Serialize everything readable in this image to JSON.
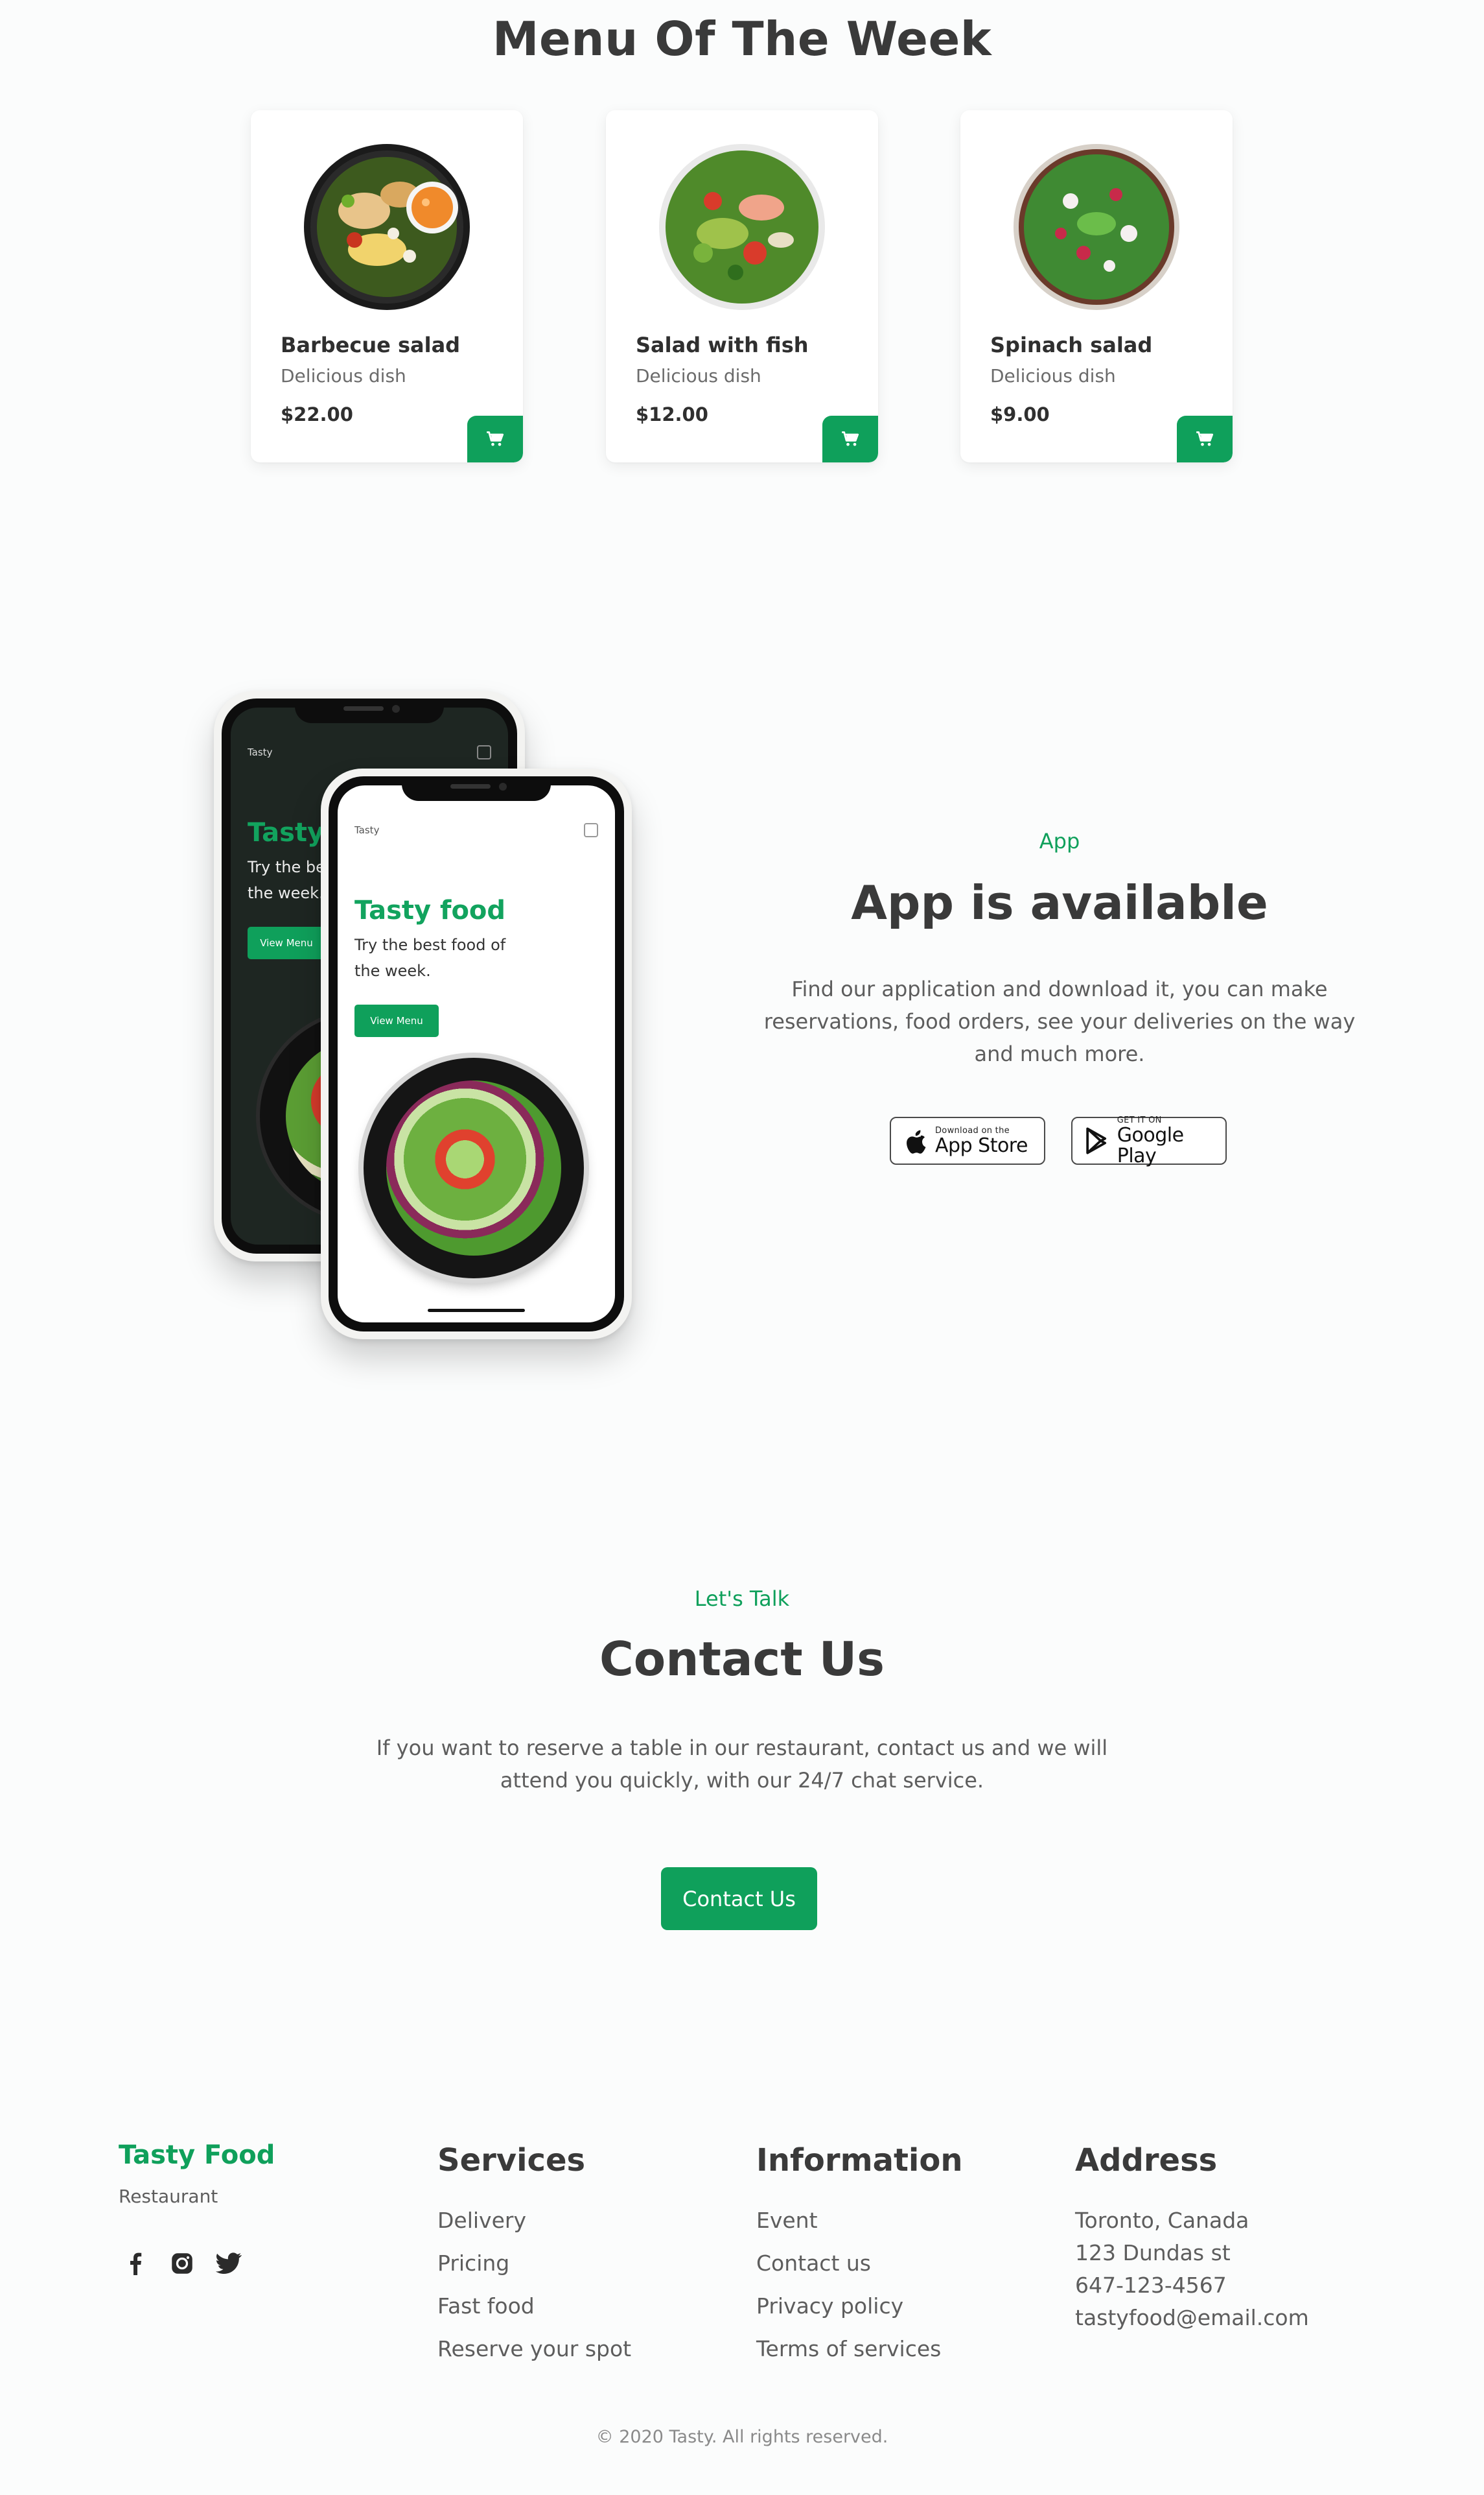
{
  "menu": {
    "title": "Menu Of The Week",
    "items": [
      {
        "name": "Barbecue salad",
        "desc": "Delicious dish",
        "price": "$22.00"
      },
      {
        "name": "Salad with fish",
        "desc": "Delicious dish",
        "price": "$12.00"
      },
      {
        "name": "Spinach salad",
        "desc": "Delicious dish",
        "price": "$9.00"
      }
    ],
    "cart_icon": "cart-icon"
  },
  "app": {
    "eyebrow": "App",
    "title": "App is available",
    "description_lines": [
      "Find our application and download it, you can make",
      "reservations, food orders, see your deliveries on the way",
      "and much more."
    ],
    "app_store": {
      "small": "Download on the",
      "big": "App Store"
    },
    "google_play": {
      "small": "GET IT ON",
      "big": "Google Play"
    },
    "phone_back": {
      "brand": "Tasty",
      "headline": "Tasty food",
      "line1": "Try the best food of",
      "line2": "the week.",
      "button": "View Menu"
    },
    "phone_front": {
      "brand": "Tasty",
      "headline": "Tasty food",
      "line1": "Try the best food of",
      "line2": "the week.",
      "button": "View Menu"
    }
  },
  "contact": {
    "eyebrow": "Let's Talk",
    "title": "Contact Us",
    "description_lines": [
      "If you want to reserve a table in our restaurant, contact us and we will",
      "attend you quickly, with our 24/7 chat service."
    ],
    "button": "Contact Us"
  },
  "footer": {
    "brand": "Tasty Food",
    "brand_sub": "Restaurant",
    "social": [
      "facebook-icon",
      "instagram-icon",
      "twitter-icon"
    ],
    "services": {
      "title": "Services",
      "links": [
        "Delivery",
        "Pricing",
        "Fast food",
        "Reserve your spot"
      ]
    },
    "information": {
      "title": "Information",
      "links": [
        "Event",
        "Contact us",
        "Privacy policy",
        "Terms of services"
      ]
    },
    "address": {
      "title": "Address",
      "lines": [
        "Toronto, Canada",
        "123 Dundas st",
        "647-123-4567",
        "tastyfood@email.com"
      ]
    },
    "copyright": "© 2020 Tasty. All rights reserved."
  },
  "colors": {
    "accent": "#0fa05b",
    "heading": "#3a3a3a",
    "text": "#5d5d5d",
    "background": "#fbfcfc"
  }
}
